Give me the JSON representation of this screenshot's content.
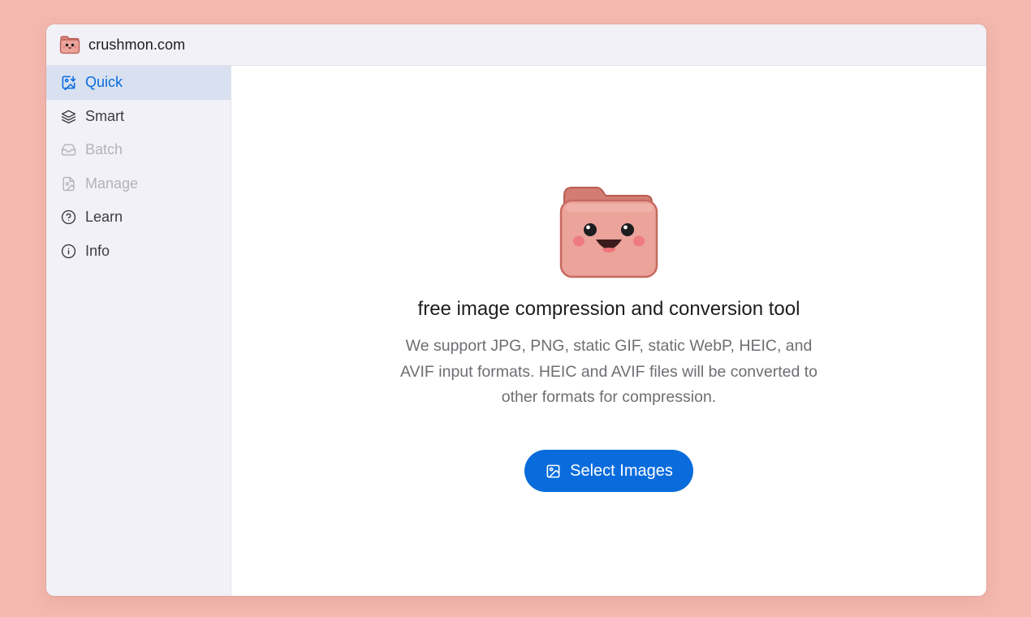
{
  "window": {
    "site_title": "crushmon.com",
    "logo_icon": "folder-mascot-icon"
  },
  "sidebar": {
    "items": [
      {
        "label": "Quick",
        "icon": "image-download-icon",
        "state": "active"
      },
      {
        "label": "Smart",
        "icon": "layers-icon",
        "state": "normal"
      },
      {
        "label": "Batch",
        "icon": "inbox-icon",
        "state": "disabled"
      },
      {
        "label": "Manage",
        "icon": "file-image-icon",
        "state": "disabled"
      },
      {
        "label": "Learn",
        "icon": "help-circle-icon",
        "state": "normal"
      },
      {
        "label": "Info",
        "icon": "info-circle-icon",
        "state": "normal"
      }
    ]
  },
  "main": {
    "headline": "free image compression and conversion tool",
    "description_lines": [
      "We support JPG, PNG, static GIF, static WebP, HEIC, and",
      "AVIF input formats. HEIC and AVIF files will be converted to",
      "other formats for compression."
    ],
    "select_button_label": "Select Images",
    "select_button_icon": "image-icon"
  },
  "colors": {
    "background": "#f4b8ae",
    "accent": "#0a6cdc",
    "sidebar_bg": "#f1f1f7",
    "active_item_bg": "#d9e1f1",
    "disabled_text": "#b3b3ba",
    "mascot_body": "#eba39a",
    "mascot_outline": "#c76a60"
  }
}
